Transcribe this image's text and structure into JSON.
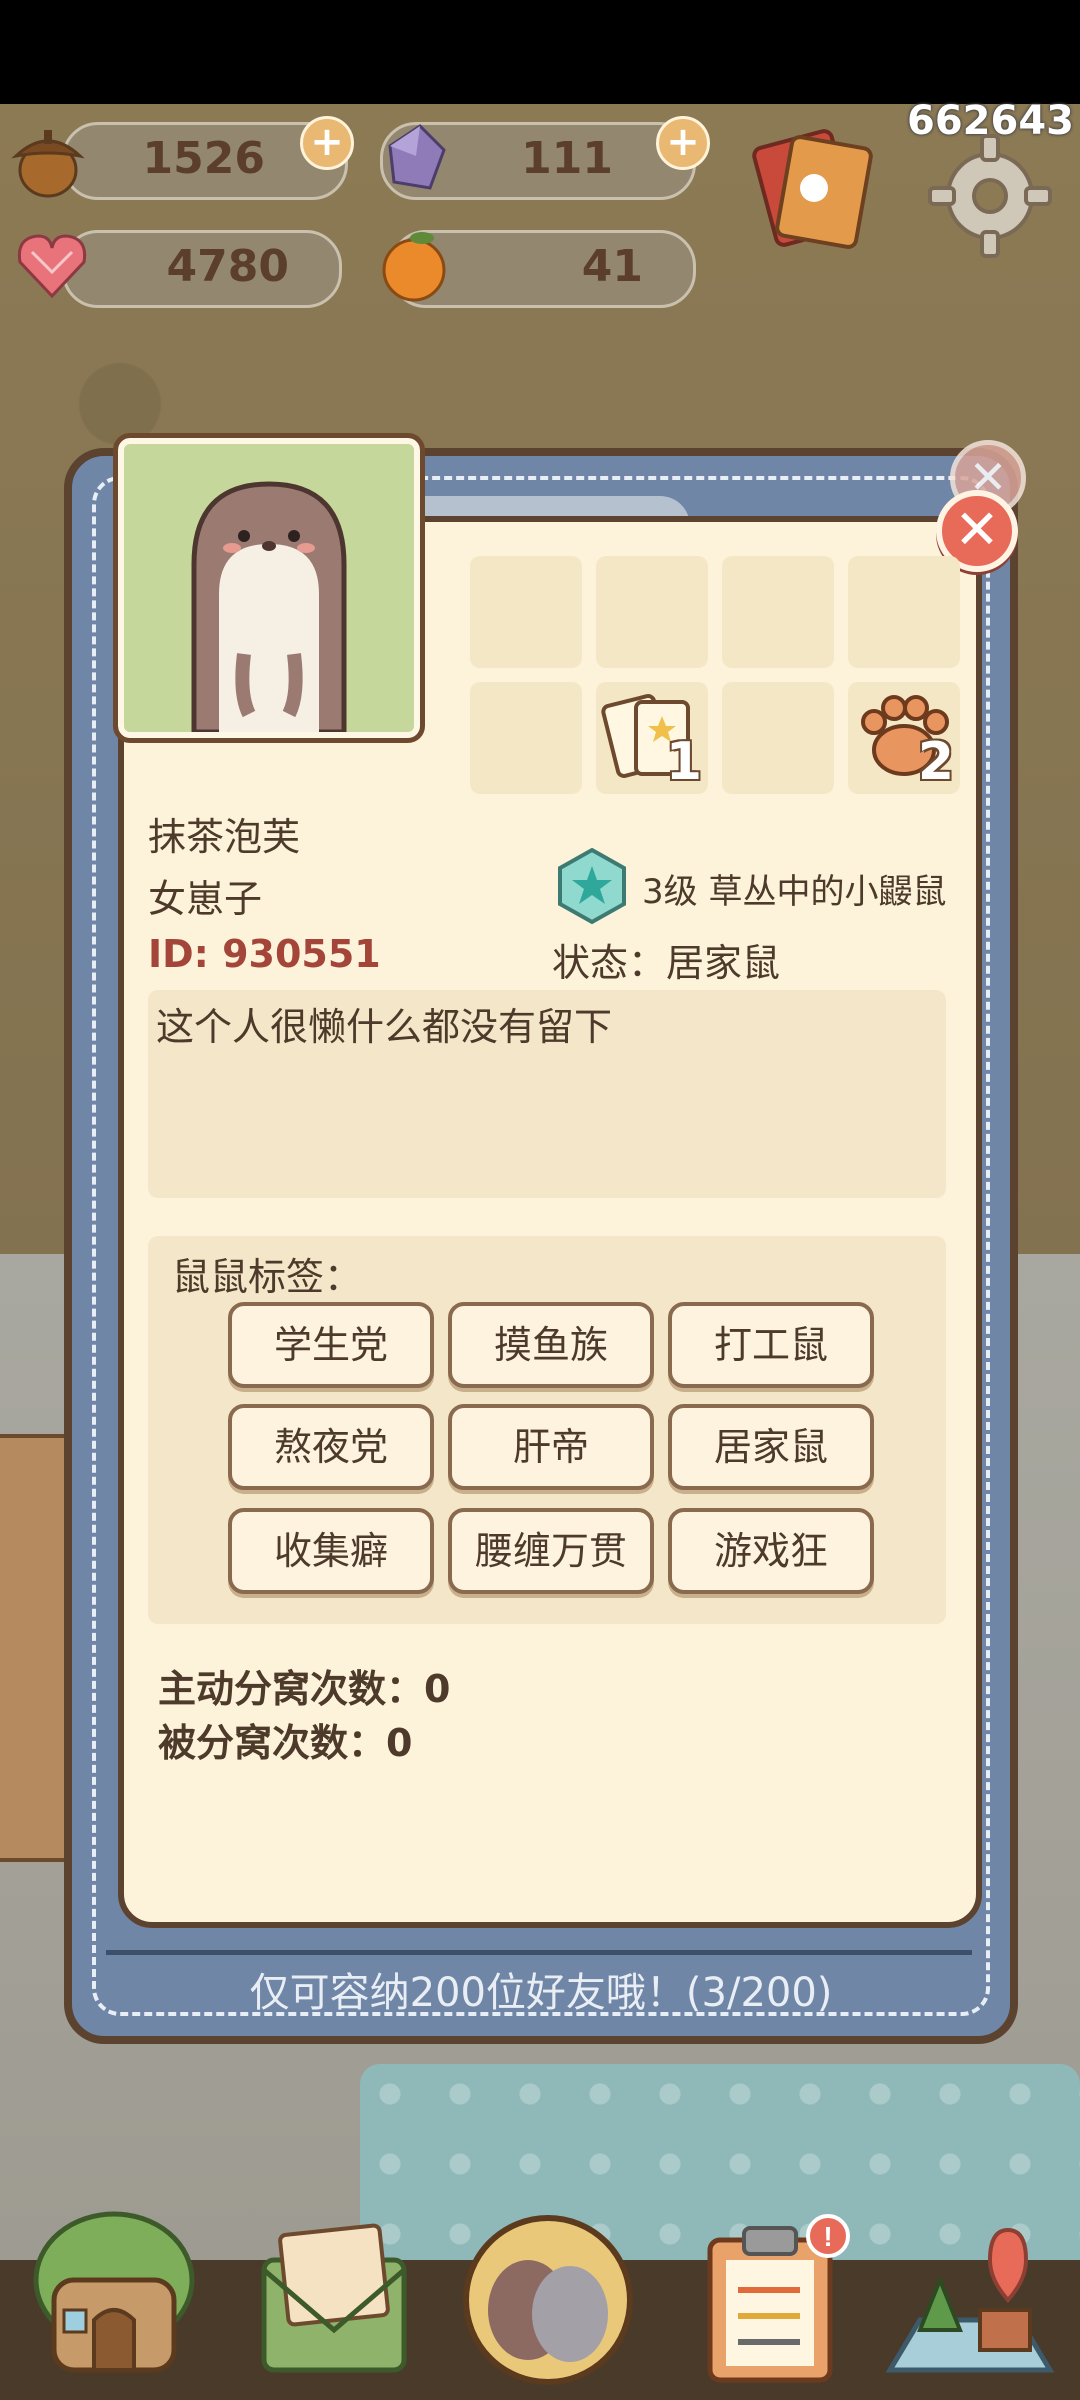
{
  "top_right_number": "662643",
  "resources": {
    "acorn": {
      "value": "1526",
      "icon": "acorn-icon"
    },
    "crystal": {
      "value": "111",
      "icon": "crystal-icon"
    },
    "heart": {
      "value": "4780",
      "icon": "heart-gem-icon"
    },
    "orange": {
      "value": "41",
      "icon": "orange-icon"
    }
  },
  "profile": {
    "name": "抹茶泡芙",
    "gender": "女崽子",
    "id_text": "ID: 930551",
    "level_text": "3级 草丛中的小鼹鼠",
    "status_text": "状态：居家鼠",
    "bio": "这个人很懒什么都没有留下"
  },
  "slots": {
    "cards_count": "1",
    "paw_count": "2"
  },
  "tags": {
    "title": "鼠鼠标签：",
    "items": [
      "学生党",
      "摸鱼族",
      "打工鼠",
      "熬夜党",
      "肝帝",
      "居家鼠",
      "收集癖",
      "腰缠万贯",
      "游戏狂"
    ]
  },
  "stats": {
    "active_split": "主动分窝次数：0",
    "passive_split": "被分窝次数：0"
  },
  "footer": "仅可容纳200位好友哦！(3/200)",
  "colors": {
    "panel_blue": "#6f86a6",
    "panel_cream": "#fdf3da",
    "close_red": "#e86b5a",
    "id_red": "#a4453a"
  }
}
